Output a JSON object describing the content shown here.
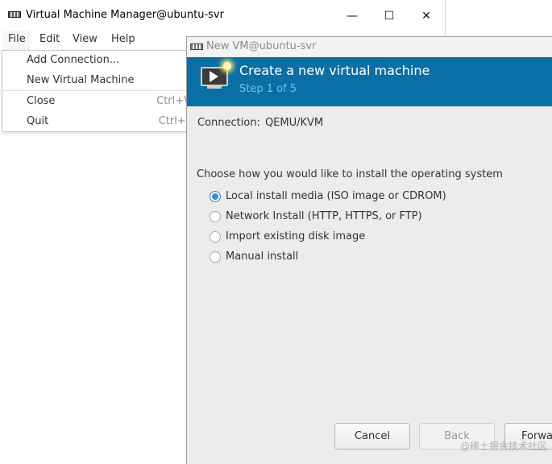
{
  "main_window": {
    "title": "Virtual Machine Manager@ubuntu-svr",
    "controls": {
      "minimize": "—",
      "maximize": "☐",
      "close": "✕"
    }
  },
  "menubar": {
    "items": [
      {
        "label": "File"
      },
      {
        "label": "Edit"
      },
      {
        "label": "View"
      },
      {
        "label": "Help"
      }
    ]
  },
  "file_menu": {
    "items": [
      {
        "label": "Add Connection...",
        "accel": ""
      },
      {
        "label": "New Virtual Machine",
        "accel": ""
      },
      {
        "label": "Close",
        "accel": "Ctrl+W"
      },
      {
        "label": "Quit",
        "accel": "Ctrl+Q"
      }
    ]
  },
  "dialog": {
    "title": "New VM@ubuntu-svr",
    "banner": {
      "title": "Create a new virtual machine",
      "step": "Step 1 of 5",
      "bg_color": "#0a6fa4"
    },
    "connection": {
      "label": "Connection:",
      "value": "QEMU/KVM"
    },
    "prompt": "Choose how you would like to install the operating system",
    "options": [
      {
        "label": "Local install media (ISO image or CDROM)",
        "selected": true
      },
      {
        "label": "Network Install (HTTP, HTTPS, or FTP)",
        "selected": false
      },
      {
        "label": "Import existing disk image",
        "selected": false
      },
      {
        "label": "Manual install",
        "selected": false
      }
    ],
    "buttons": {
      "cancel": "Cancel",
      "back": "Back",
      "forward": "Forwa"
    }
  },
  "watermark": "@稀土掘金技术社区"
}
